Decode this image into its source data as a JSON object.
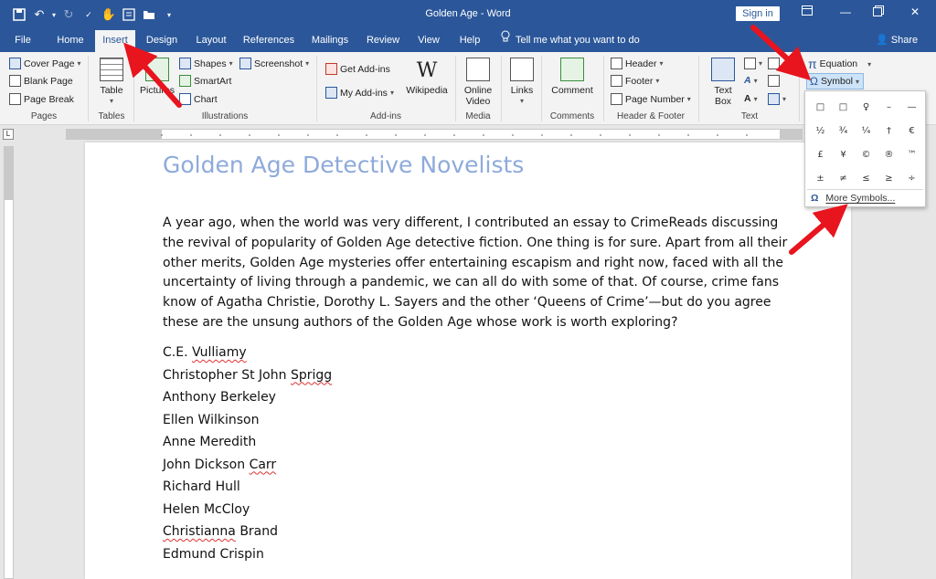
{
  "window": {
    "title": "Golden Age  -  Word",
    "signin_label": "Sign in",
    "share_label": "Share",
    "tell_me": "Tell me what you want to do"
  },
  "tabs": [
    "File",
    "Home",
    "Insert",
    "Design",
    "Layout",
    "References",
    "Mailings",
    "Review",
    "View",
    "Help"
  ],
  "active_tab": "Insert",
  "ribbon": {
    "pages": {
      "cover_page": "Cover Page",
      "blank_page": "Blank Page",
      "page_break": "Page Break",
      "label": "Pages"
    },
    "tables": {
      "table": "Table",
      "label": "Tables"
    },
    "illustrations": {
      "pictures": "Pictures",
      "shapes": "Shapes",
      "smartart": "SmartArt",
      "chart": "Chart",
      "screenshot": "Screenshot",
      "label": "Illustrations"
    },
    "addins": {
      "get_addins": "Get Add-ins",
      "my_addins": "My Add-ins",
      "wikipedia": "Wikipedia",
      "label": "Add-ins"
    },
    "media": {
      "online_video_1": "Online",
      "online_video_2": "Video",
      "label": "Media"
    },
    "links": {
      "links": "Links"
    },
    "comments": {
      "comment": "Comment",
      "label": "Comments"
    },
    "header_footer": {
      "header": "Header",
      "footer": "Footer",
      "page_number": "Page Number",
      "label": "Header & Footer"
    },
    "text": {
      "text_box_1": "Text",
      "text_box_2": "Box",
      "label": "Text"
    },
    "symbols": {
      "equation": "Equation",
      "symbol": "Symbol"
    }
  },
  "symbol_menu": {
    "symbols": [
      "□",
      "□",
      "♀",
      "–",
      "—",
      "½",
      "¾",
      "¼",
      "†",
      "€",
      "£",
      "¥",
      "©",
      "®",
      "™",
      "±",
      "≠",
      "≤",
      "≥",
      "÷"
    ],
    "more_symbols": "More Symbols..."
  },
  "document": {
    "title": "Golden Age Detective Novelists",
    "paragraph": "A year ago, when the world was very different, I contributed an essay to CrimeReads discussing the revival of popularity of Golden Age detective fiction. One thing is for sure. Apart from all their other merits, Golden Age mysteries offer entertaining escapism and right now, faced with all the uncertainty of living through a pandemic, we can all do with some of that. Of course, crime fans know of Agatha Christie, Dorothy L. Sayers and the other ‘Queens of Crime’—but do you agree these are the unsung authors of the Golden Age whose work is worth exploring?",
    "authors": [
      {
        "first": "C.E. ",
        "flagged": "Vulliamy",
        "rest": ""
      },
      {
        "first": "Christopher St John ",
        "flagged": "Sprigg",
        "rest": ""
      },
      {
        "first": "Anthony Berkeley",
        "flagged": "",
        "rest": ""
      },
      {
        "first": "Ellen Wilkinson",
        "flagged": "",
        "rest": ""
      },
      {
        "first": "Anne Meredith",
        "flagged": "",
        "rest": ""
      },
      {
        "first": "John Dickson ",
        "flagged": "Carr",
        "rest": ""
      },
      {
        "first": "Richard Hull",
        "flagged": "",
        "rest": ""
      },
      {
        "first": "Helen McCloy",
        "flagged": "",
        "rest": ""
      },
      {
        "first": "",
        "flagged": "Christianna",
        "rest": " Brand"
      },
      {
        "first": "Edmund Crispin",
        "flagged": "",
        "rest": ""
      }
    ]
  },
  "colors": {
    "accent": "#2b579a",
    "title": "#8eaadb",
    "arrow": "#e8141e"
  }
}
